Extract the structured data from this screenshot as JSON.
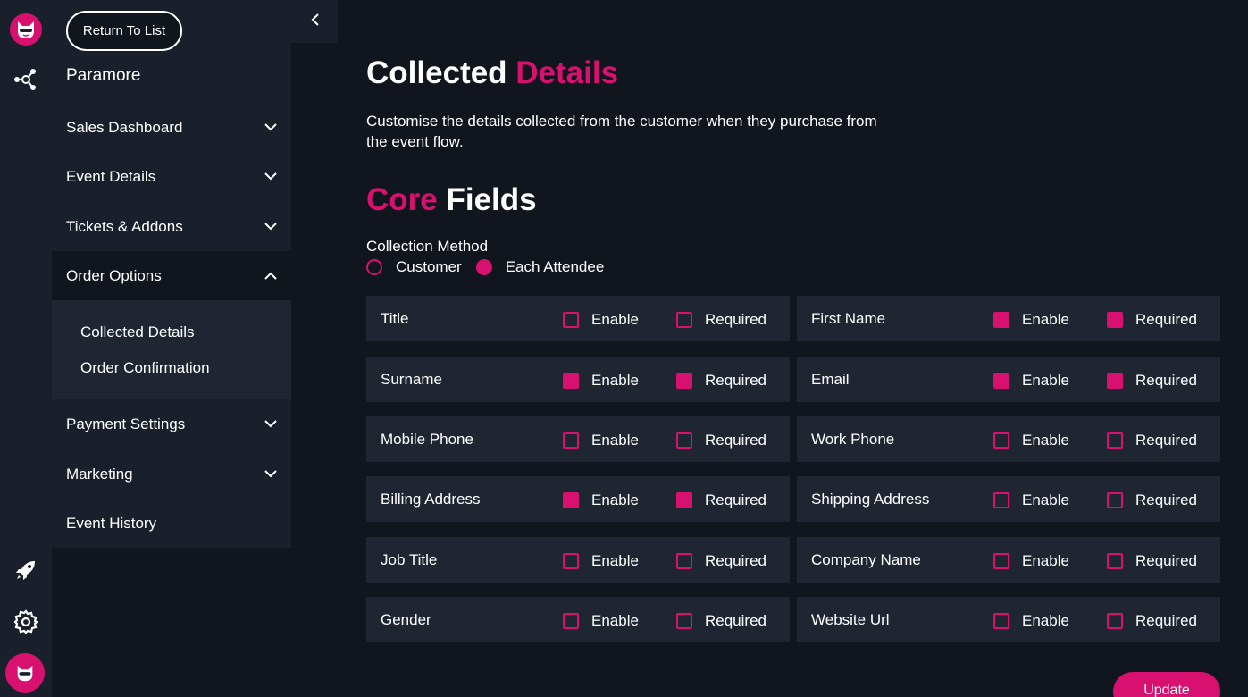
{
  "colors": {
    "accent": "#d8106f",
    "background": "#11161e",
    "panel": "#1a202b",
    "row": "#1f2632"
  },
  "rail": {
    "logo_icon": "cat-logo-icon",
    "icons": [
      "network-icon",
      "rocket-icon",
      "gear-icon"
    ],
    "avatar_icon": "cat-avatar-icon"
  },
  "sidebar": {
    "return_label": "Return To List",
    "event_name": "Paramore",
    "items": [
      {
        "label": "Sales Dashboard",
        "icon": "chevron-down-icon"
      },
      {
        "label": "Event Details",
        "icon": "chevron-down-icon"
      },
      {
        "label": "Tickets & Addons",
        "icon": "chevron-down-icon"
      },
      {
        "label": "Order Options",
        "icon": "chevron-up-icon"
      },
      {
        "label": "Payment Settings",
        "icon": "chevron-down-icon"
      },
      {
        "label": "Marketing",
        "icon": "chevron-down-icon"
      },
      {
        "label": "Event History"
      }
    ],
    "subitems": [
      "Collected Details",
      "Order Confirmation"
    ]
  },
  "main": {
    "title_white": "Collected",
    "title_pink": "Details",
    "description": "Customise the details collected from the customer when they purchase from the event flow.",
    "core_pink": "Core",
    "core_white": "Fields",
    "collection_method_label": "Collection Method",
    "collection_options": [
      {
        "label": "Customer",
        "selected": false
      },
      {
        "label": "Each Attendee",
        "selected": true
      }
    ],
    "enable_label": "Enable",
    "required_label": "Required",
    "fields": [
      {
        "label": "Title",
        "enable": false,
        "required": false
      },
      {
        "label": "First Name",
        "enable": true,
        "required": true
      },
      {
        "label": "Surname",
        "enable": true,
        "required": true
      },
      {
        "label": "Email",
        "enable": true,
        "required": true
      },
      {
        "label": "Mobile Phone",
        "enable": false,
        "required": false
      },
      {
        "label": "Work Phone",
        "enable": false,
        "required": false
      },
      {
        "label": "Billing Address",
        "enable": true,
        "required": true
      },
      {
        "label": "Shipping Address",
        "enable": false,
        "required": false
      },
      {
        "label": "Job Title",
        "enable": false,
        "required": false
      },
      {
        "label": "Company Name",
        "enable": false,
        "required": false
      },
      {
        "label": "Gender",
        "enable": false,
        "required": false
      },
      {
        "label": "Website Url",
        "enable": false,
        "required": false
      }
    ],
    "update_label": "Update"
  }
}
